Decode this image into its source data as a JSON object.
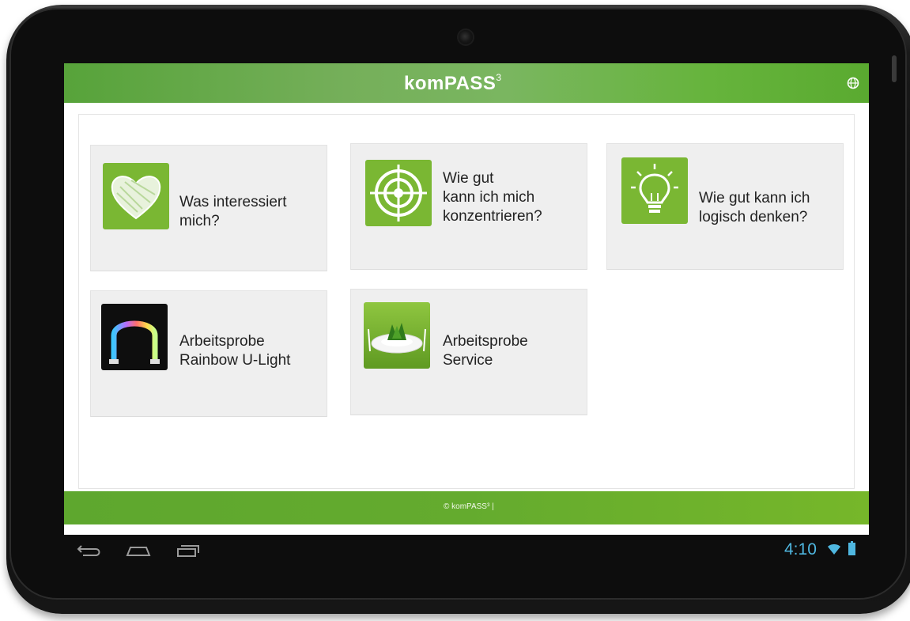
{
  "header": {
    "logo_text": "komPASS",
    "logo_superscript": "3",
    "language_icon": "globe-icon"
  },
  "tiles": [
    {
      "label": "Was interessiert\nmich?",
      "icon": "heart-icon"
    },
    {
      "label": "Wie gut\nkann ich mich\nkonzentrieren?",
      "icon": "target-icon"
    },
    {
      "label": "Wie gut kann ich\nlogisch denken?",
      "icon": "lightbulb-icon"
    },
    {
      "label": "Arbeitsprobe\nRainbow U-Light",
      "icon": "rainbow-u-light-image"
    },
    {
      "label": "Arbeitsprobe\nService",
      "icon": "service-plate-image"
    }
  ],
  "footer": {
    "copyright": "© komPASS³ |"
  },
  "system_bar": {
    "time": "4:10",
    "back_icon": "back-icon",
    "home_icon": "home-icon",
    "recents_icon": "recents-icon",
    "wifi_icon": "wifi-icon",
    "battery_icon": "battery-icon"
  },
  "colors": {
    "brand_green": "#66b43c",
    "tile_icon_green": "#7ab733",
    "status_blue": "#4fb7e0"
  }
}
